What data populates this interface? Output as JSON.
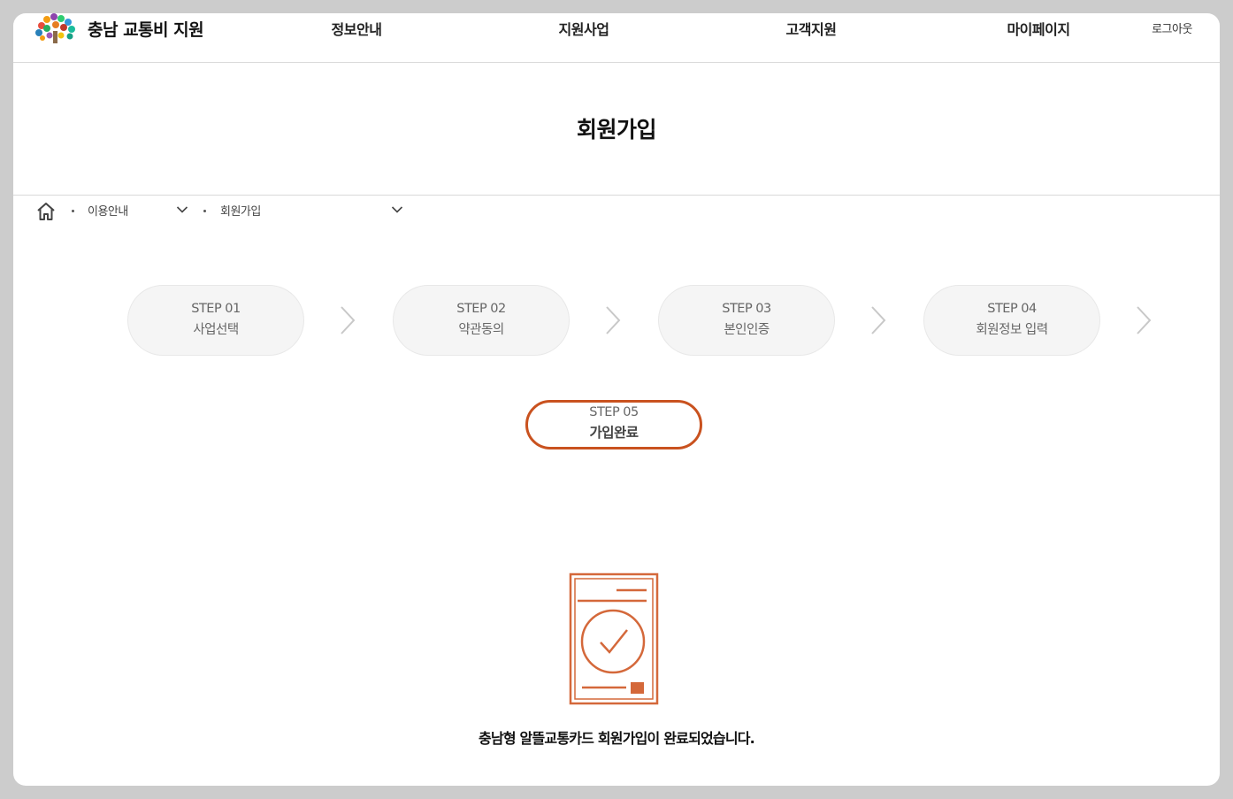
{
  "header": {
    "logo_text": "충남 교통비 지원",
    "nav": [
      "정보안내",
      "지원사업",
      "고객지원",
      "마이페이지"
    ],
    "logout": "로그아웃"
  },
  "page_title": "회원가입",
  "breadcrumb": {
    "level1": "이용안내",
    "level2": "회원가입"
  },
  "steps": [
    {
      "num": "STEP 01",
      "label": "사업선택"
    },
    {
      "num": "STEP 02",
      "label": "약관동의"
    },
    {
      "num": "STEP 03",
      "label": "본인인증"
    },
    {
      "num": "STEP 04",
      "label": "회원정보 입력"
    },
    {
      "num": "STEP 05",
      "label": "가입완료"
    }
  ],
  "message": "충남형 알뜰교통카드 회원가입이 완료되었습니다.",
  "colors": {
    "accent": "#c9521f",
    "icon": "#d4683a",
    "step_bg": "#f5f5f5"
  }
}
